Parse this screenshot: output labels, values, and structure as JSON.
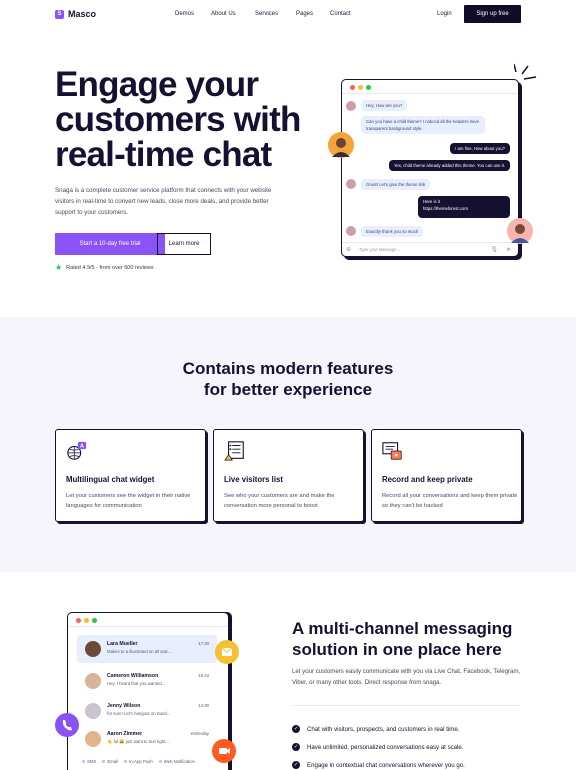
{
  "nav": {
    "logo_mark": "S",
    "logo_text": "Masco",
    "items": [
      "Demos",
      "About Us",
      "Services",
      "Pages",
      "Contact"
    ],
    "login": "Login",
    "signup": "Sign up free"
  },
  "hero": {
    "title": "Engage your customers with real-time chat",
    "description": "Snaga is a complete customer service platform that connects with your website visitors in real-time to convert new leads, close more deals, and provide better support to your customers.",
    "cta_primary": "Start a 10-day free trial",
    "cta_secondary": "Learn more",
    "rating": "Rated 4.9/5 - from over 600 reviews"
  },
  "chat": {
    "messages": [
      {
        "side": "in",
        "text": "Hey, How are you?"
      },
      {
        "side": "in",
        "text": "Can you have a child theme? I noticed all the headers have transparent background style."
      },
      {
        "side": "out",
        "text": "I am fine, How about you?"
      },
      {
        "side": "out",
        "text": "Yes, child theme already added this theme. You can use it."
      },
      {
        "side": "in",
        "text": "Great! Let's give the theme link"
      },
      {
        "side": "out",
        "text": "Here is it"
      },
      {
        "side": "out",
        "text": "https://themeforest.com"
      },
      {
        "side": "in",
        "text": "Exactly! thank you so much"
      }
    ],
    "input_placeholder": "Type your Message..."
  },
  "features": {
    "title_line1": "Contains modern features",
    "title_line2": "for better experience",
    "cards": [
      {
        "title": "Multilingual chat widget",
        "text": "Let your customers see the widget in their native languages for communication",
        "icon": "globe-language-icon"
      },
      {
        "title": "Live visitors list",
        "text": "See who your customers are and make the conversation more personal to boost",
        "icon": "visitors-list-icon"
      },
      {
        "title": "Record and keep private",
        "text": "Record all your conversations and keep them private so they can't be hacked",
        "icon": "private-record-icon"
      }
    ]
  },
  "inbox": {
    "rows": [
      {
        "name": "Lara Mueller",
        "message": "Makes to a illustrated on all and...",
        "time": "17:30"
      },
      {
        "name": "Cameron Williamson",
        "message": "Hey, I heard that you wanted...",
        "time": "16:43"
      },
      {
        "name": "Jenny Wilson",
        "message": "for sure! Let's hangout on Sund...",
        "time": "14:30"
      },
      {
        "name": "Aaron Zimmer",
        "message": "👋 fal 😀 just want to text right...",
        "time": "Yesterday"
      }
    ],
    "channels": [
      "SMS",
      "Email",
      "In-App Push",
      "Web Notification"
    ]
  },
  "multichannel": {
    "title": "A multi-channel messaging solution in one place here",
    "description": "Let your customers easily communicate with you via Live Chat, Facebook, Telegram, Viber, or many other tools. Direct response from snaga.",
    "checks": [
      "Chat with visitors, prospects, and customers in real time.",
      "Have unlimited, personalized conversations easy at scale.",
      "Engage in contextual chat conversations wherever you go."
    ]
  },
  "colors": {
    "primary": "#8a53f5",
    "dark": "#141131",
    "soft_bg": "#f7f5fc",
    "bubble_in": "#e8eefe",
    "rating_star": "#22c55e",
    "email_badge": "#f6c034",
    "video_badge": "#ff5a1f"
  }
}
